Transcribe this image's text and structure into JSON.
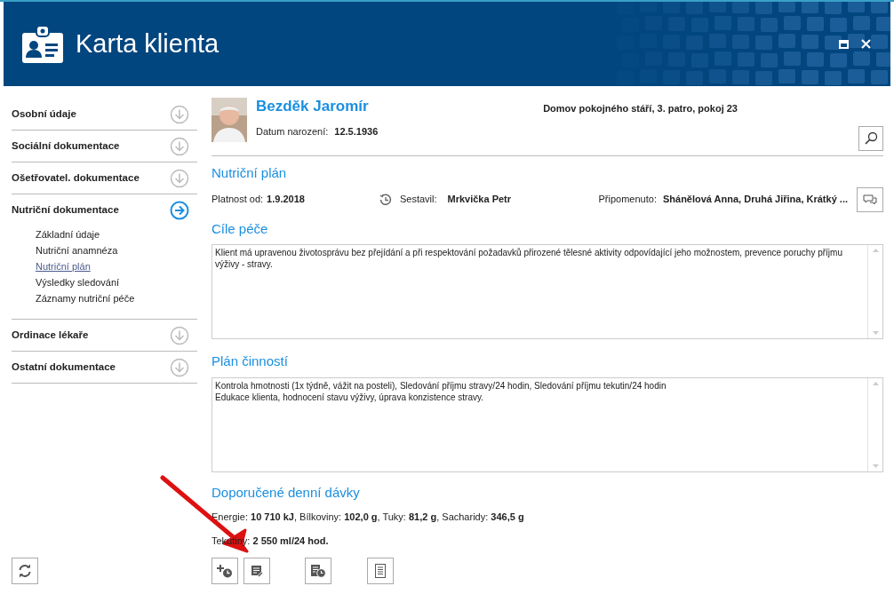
{
  "window": {
    "title": "Karta klienta"
  },
  "sidebar": {
    "sections": [
      {
        "title": "Osobní údaje",
        "expanded": false
      },
      {
        "title": "Sociální dokumentace",
        "expanded": false
      },
      {
        "title": "Ošetřovatel. dokumentace",
        "expanded": false
      },
      {
        "title": "Nutriční dokumentace",
        "expanded": true,
        "children": [
          {
            "label": "Základní údaje",
            "selected": false
          },
          {
            "label": "Nutriční anamnéza",
            "selected": false
          },
          {
            "label": "Nutriční plán",
            "selected": true
          },
          {
            "label": "Výsledky sledování",
            "selected": false
          },
          {
            "label": "Záznamy nutriční péče",
            "selected": false
          }
        ]
      },
      {
        "title": "Ordinace lékaře",
        "expanded": false
      },
      {
        "title": "Ostatní dokumentace",
        "expanded": false
      }
    ]
  },
  "client": {
    "name": "Bezděk Jaromír",
    "birth_label": "Datum narození:",
    "birth_date": "12.5.1936",
    "location": "Domov pokojného stáří, 3. patro, pokoj 23"
  },
  "plan": {
    "title": "Nutriční plán",
    "valid_label": "Platnost od:",
    "valid_from": "1.9.2018",
    "author_label": "Sestavil:",
    "author": "Mrkvička Petr",
    "reminded_label": "Připomenuto:",
    "reminded": "Shánělová Anna, Druhá Jiřina, Krátký ..."
  },
  "sections": [
    {
      "title": "Cíle péče",
      "text": "Klient má upravenou životosprávu bez přejídání a při respektování požadavků přirozené tělesné aktivity odpovídající jeho možnostem, prevence poruchy příjmu výživy - stravy."
    },
    {
      "title": "Plán činností",
      "text": "Kontrola hmotnosti (1x týdně, vážit na posteli), Sledování příjmu stravy/24 hodin, Sledování příjmu tekutin/24 hodin\nEdukace klienta, hodnocení stavu výživy, úprava konzistence stravy."
    }
  ],
  "doses": {
    "title": "Doporučené denní dávky",
    "lines": [
      "Energie: **10 710 kJ**, Bílkoviny: **102,0 g**, Tuky: **81,2 g**, Sacharidy: **346,5 g**",
      "Tekutiny: **2 550 ml/24 hod.**"
    ]
  }
}
